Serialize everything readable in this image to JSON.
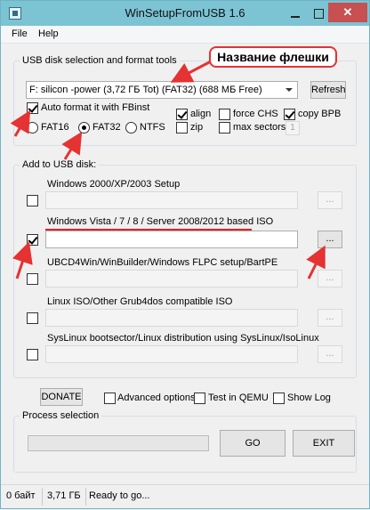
{
  "window": {
    "title": "WinSetupFromUSB 1.6",
    "controls": {
      "minimize": "",
      "maximize": "",
      "close": "✕"
    }
  },
  "menu": {
    "file": "File",
    "help": "Help"
  },
  "usb_group": {
    "label": "USB disk selection and format tools",
    "disk_select": "F: silicon -power (3,72 ГБ Tot) (FAT32) (688 МБ Free)",
    "refresh_button": "Refresh",
    "auto_format": {
      "label": "Auto format it with FBinst",
      "checked": true
    },
    "filesystems": [
      {
        "label": "FAT16",
        "selected": false
      },
      {
        "label": "FAT32",
        "selected": true
      },
      {
        "label": "NTFS",
        "selected": false
      }
    ],
    "align": {
      "label": "align",
      "checked": true
    },
    "zip": {
      "label": "zip",
      "checked": false
    },
    "force_chs": {
      "label": "force CHS",
      "checked": false
    },
    "copy_bpb": {
      "label": "copy BPB",
      "checked": true
    },
    "max_sectors": {
      "label": "max sectors",
      "checked": false,
      "value": "1"
    }
  },
  "add_group": {
    "label": "Add to USB disk:",
    "entries": [
      {
        "label": "Windows 2000/XP/2003 Setup",
        "checked": false,
        "path": "",
        "browse": "..."
      },
      {
        "label": "Windows Vista / 7 / 8 / Server 2008/2012 based ISO",
        "checked": true,
        "path": "",
        "browse": "..."
      },
      {
        "label": "UBCD4Win/WinBuilder/Windows FLPC setup/BartPE",
        "checked": false,
        "path": "",
        "browse": "..."
      },
      {
        "label": "Linux ISO/Other Grub4dos compatible ISO",
        "checked": false,
        "path": "",
        "browse": "..."
      },
      {
        "label": "SysLinux bootsector/Linux distribution using SysLinux/IsoLinux",
        "checked": false,
        "path": "",
        "browse": "..."
      }
    ]
  },
  "options": {
    "donate": "DONATE",
    "advanced": {
      "label": "Advanced options",
      "checked": false
    },
    "test_qemu": {
      "label": "Test in QEMU",
      "checked": false
    },
    "show_log": {
      "label": "Show Log",
      "checked": false
    }
  },
  "process": {
    "label": "Process selection",
    "progress": 0,
    "go": "GO",
    "exit": "EXIT"
  },
  "status": {
    "bytes": "0 байт",
    "size": "3,71 ГБ",
    "message": "Ready to go..."
  },
  "annotation": {
    "text": "Название флешки",
    "color": "#e53232"
  }
}
